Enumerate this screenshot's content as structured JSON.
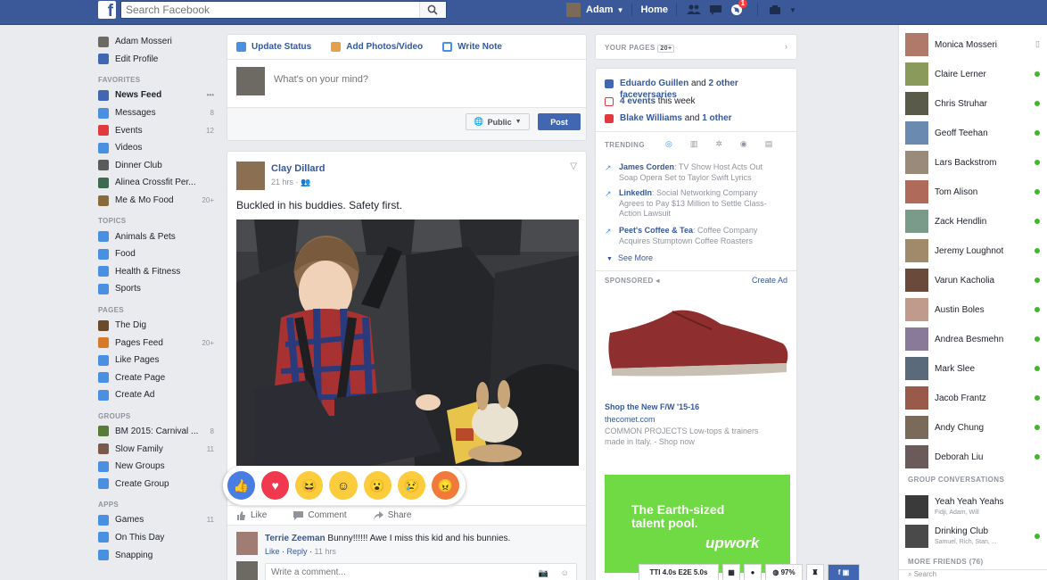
{
  "header": {
    "logo_text": "f",
    "search_placeholder": "Search Facebook",
    "user_name": "Adam",
    "home_label": "Home",
    "notification_count": "1"
  },
  "left_nav": {
    "profile": [
      {
        "label": "Adam Mosseri",
        "color": "#6d6a63"
      },
      {
        "label": "Edit Profile",
        "color": "#4267b2"
      }
    ],
    "favorites_heading": "FAVORITES",
    "favorites": [
      {
        "label": "News Feed",
        "color": "#4267b2",
        "count": ""
      },
      {
        "label": "Messages",
        "color": "#4a90e2",
        "count": "8"
      },
      {
        "label": "Events",
        "color": "#e0393e",
        "count": "12"
      },
      {
        "label": "Videos",
        "color": "#4a90e2",
        "count": ""
      },
      {
        "label": "Dinner Club",
        "color": "#5b5b5b",
        "count": ""
      },
      {
        "label": "Alinea Crossfit Per...",
        "color": "#3d6b4f",
        "count": ""
      },
      {
        "label": "Me & Mo Food",
        "color": "#8a6a3a",
        "count": "20+"
      }
    ],
    "topics_heading": "TOPICS",
    "topics": [
      {
        "label": "Animals & Pets",
        "color": "#4a90e2"
      },
      {
        "label": "Food",
        "color": "#4a90e2"
      },
      {
        "label": "Health & Fitness",
        "color": "#4a90e2"
      },
      {
        "label": "Sports",
        "color": "#4a90e2"
      }
    ],
    "pages_heading": "PAGES",
    "pages": [
      {
        "label": "The Dig",
        "color": "#6a4a2a",
        "count": ""
      },
      {
        "label": "Pages Feed",
        "color": "#d67a2a",
        "count": "20+"
      },
      {
        "label": "Like Pages",
        "color": "#4a90e2",
        "count": ""
      },
      {
        "label": "Create Page",
        "color": "#4a90e2",
        "count": ""
      },
      {
        "label": "Create Ad",
        "color": "#4a90e2",
        "count": ""
      }
    ],
    "groups_heading": "GROUPS",
    "groups": [
      {
        "label": "BM 2015: Carnival ...",
        "color": "#5a7a3a",
        "count": "8"
      },
      {
        "label": "Slow Family",
        "color": "#7a5a4a",
        "count": "11"
      },
      {
        "label": "New Groups",
        "color": "#4a90e2",
        "count": ""
      },
      {
        "label": "Create Group",
        "color": "#4a90e2",
        "count": ""
      }
    ],
    "apps_heading": "APPS",
    "apps": [
      {
        "label": "Games",
        "color": "#4a90e2",
        "count": "11"
      },
      {
        "label": "On This Day",
        "color": "#4a90e2",
        "count": ""
      },
      {
        "label": "Snapping",
        "color": "#4a90e2",
        "count": ""
      }
    ]
  },
  "composer": {
    "tab_status": "Update Status",
    "tab_photo": "Add Photos/Video",
    "tab_note": "Write Note",
    "placeholder": "What's on your mind?",
    "privacy": "Public",
    "post_label": "Post"
  },
  "post": {
    "author": "Clay Dillard",
    "time": "21 hrs",
    "text": "Buckled in his buddies. Safety first.",
    "like": "Like",
    "comment": "Comment",
    "share": "Share",
    "comment_author": "Terrie Zeeman",
    "comment_text": "Bunny!!!!!! Awe I miss this kid and his bunnies.",
    "comment_like": "Like",
    "comment_reply": "Reply",
    "comment_time": "11 hrs",
    "write_placeholder": "Write a comment..."
  },
  "right_col": {
    "your_pages_heading": "YOUR PAGES",
    "your_pages_count": "20+",
    "notices": [
      {
        "bold": "Eduardo Guillen",
        "rest": " and ",
        "bold2": "2 other faceversaries",
        "color": "#4267b2"
      },
      {
        "bold": "4 events",
        "rest": " this week",
        "bold2": "",
        "color": "#e0393e"
      },
      {
        "bold": "Blake Williams",
        "rest": " and ",
        "bold2": "1 other",
        "color": "#e0393e"
      }
    ],
    "trending_heading": "TRENDING",
    "trends": [
      {
        "name": "James Corden",
        "desc": ": TV Show Host Acts Out Soap Opera Set to Taylor Swift Lyrics"
      },
      {
        "name": "LinkedIn",
        "desc": ": Social Networking Company Agrees to Pay $13 Million to Settle Class-Action Lawsuit"
      },
      {
        "name": "Peet's Coffee & Tea",
        "desc": ": Coffee Company Acquires Stumptown Coffee Roasters"
      }
    ],
    "see_more": "See More",
    "sponsored_heading": "SPONSORED",
    "create_ad": "Create Ad",
    "ad_title": "Shop the New F/W '15-16",
    "ad_domain": "thecomet.com",
    "ad_desc": "COMMON PROJECTS Low-tops & trainers made in Italy. - Shop now",
    "ad2_line1": "The Earth-sized",
    "ad2_line2": "talent pool.",
    "ad2_brand": "upwork"
  },
  "chat": {
    "friends": [
      {
        "name": "Monica Mosseri",
        "color": "#b07a6a"
      },
      {
        "name": "Claire Lerner",
        "color": "#8a9a5a"
      },
      {
        "name": "Chris Struhar",
        "color": "#5a5a4a"
      },
      {
        "name": "Geoff Teehan",
        "color": "#6a8ab0"
      },
      {
        "name": "Lars Backstrom",
        "color": "#9a8a7a"
      },
      {
        "name": "Tom Alison",
        "color": "#b06a5a"
      },
      {
        "name": "Zack Hendlin",
        "color": "#7a9a8a"
      },
      {
        "name": "Jeremy Loughnot",
        "color": "#a08a6a"
      },
      {
        "name": "Varun Kacholia",
        "color": "#6a4a3a"
      },
      {
        "name": "Austin Boles",
        "color": "#c09a8a"
      },
      {
        "name": "Andrea Besmehn",
        "color": "#8a7a9a"
      },
      {
        "name": "Mark Slee",
        "color": "#5a6a7a"
      },
      {
        "name": "Jacob Frantz",
        "color": "#9a5a4a"
      },
      {
        "name": "Andy Chung",
        "color": "#7a6a5a"
      },
      {
        "name": "Deborah Liu",
        "color": "#6a5a5a"
      }
    ],
    "group_heading": "GROUP CONVERSATIONS",
    "groups": [
      {
        "name": "Yeah Yeah Yeahs",
        "members": "Fidji, Adam, Will"
      },
      {
        "name": "Drinking Club",
        "members": "Samuel, Rich, Stan, ..."
      }
    ],
    "more_heading": "MORE FRIENDS (76)",
    "search_placeholder": "Search",
    "dock_timing": "TTI 4.0s  E2E 5.0s",
    "dock_percent": "97%"
  }
}
